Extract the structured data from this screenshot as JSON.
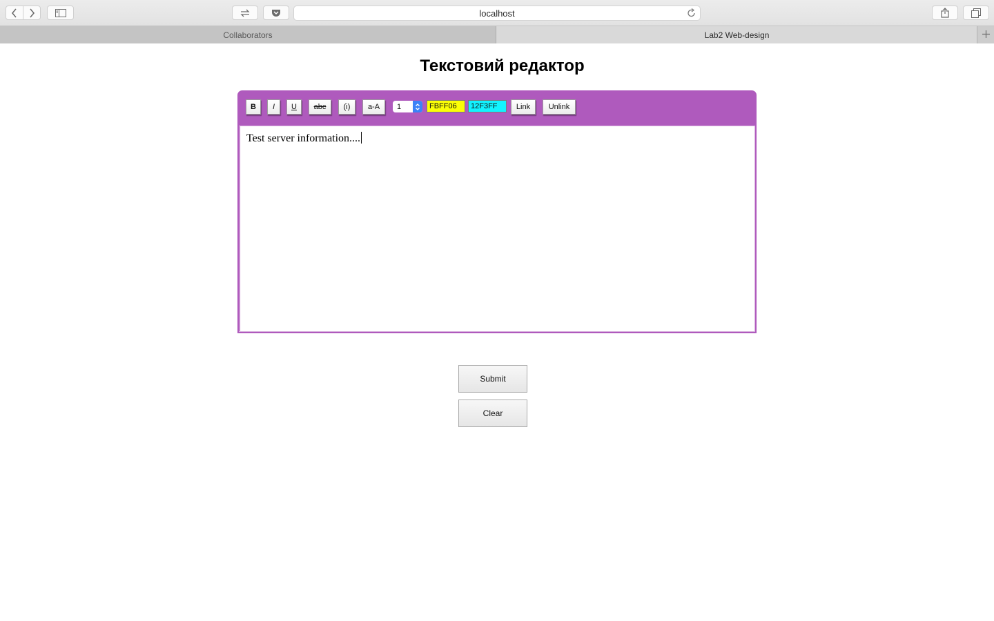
{
  "browser": {
    "address": "localhost",
    "tabs": [
      {
        "label": "Collaborators",
        "active": false
      },
      {
        "label": "Lab2 Web-design",
        "active": true
      }
    ],
    "icons": {
      "back": "chevron-left-icon",
      "forward": "chevron-right-icon",
      "sidebar": "sidebar-icon",
      "reader": "reader-icon",
      "pocket": "pocket-icon",
      "reload": "reload-icon",
      "share": "share-icon",
      "tabs_overview": "tabs-overview-icon",
      "new_tab": "plus-icon"
    }
  },
  "page": {
    "title": "Текстовий редактор"
  },
  "editor": {
    "accent_color": "#af5abd",
    "toolbar": {
      "bold": "B",
      "italic": "I",
      "underline": "U",
      "strikethrough": "abc",
      "info": "(i)",
      "case": "a-A",
      "font_size": "1",
      "text_color": "FBFF06",
      "text_color_swatch": "#fbff06",
      "bg_color": "12F3FF",
      "bg_color_swatch": "#12f3ff",
      "link": "Link",
      "unlink": "Unlink"
    },
    "content": "Test server information...."
  },
  "actions": {
    "submit": "Submit",
    "clear": "Clear"
  }
}
